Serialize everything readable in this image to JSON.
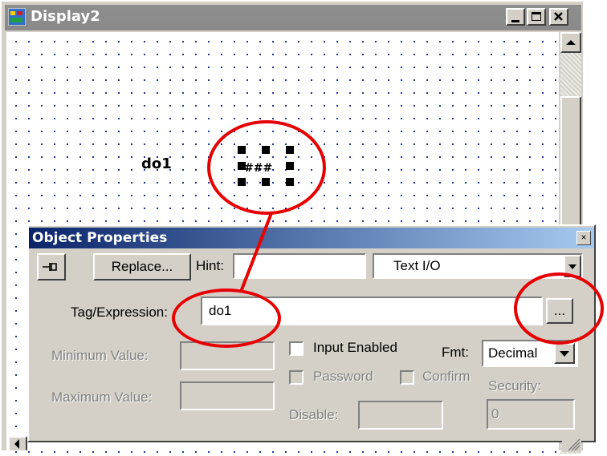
{
  "window": {
    "title": "Display2",
    "minimize_icon": "minimize-icon",
    "maximize_icon": "maximize-icon",
    "close_icon": "close-icon"
  },
  "canvas": {
    "object_label": "do1",
    "object_placeholder": "###"
  },
  "dialog": {
    "title": "Object Properties",
    "close_glyph": "×",
    "pin_icon": "pin-icon",
    "replace_label": "Replace...",
    "hint_label": "Hint:",
    "hint_value": "",
    "object_type": "Text I/O",
    "tag_label": "Tag/Expression:",
    "tag_value": "do1",
    "browse_label": "...",
    "min_label": "Minimum Value:",
    "max_label": "Maximum Value:",
    "input_enabled_label": "Input Enabled",
    "password_label": "Password",
    "confirm_label": "Confirm",
    "fmt_label": "Fmt:",
    "fmt_value": "Decimal",
    "security_label": "Security:",
    "security_value": "0",
    "disable_label": "Disable:"
  },
  "colors": {
    "annotation": "#e60000",
    "dialog_title": "#0a246a",
    "window_title_inactive": "#8a8a8a"
  }
}
